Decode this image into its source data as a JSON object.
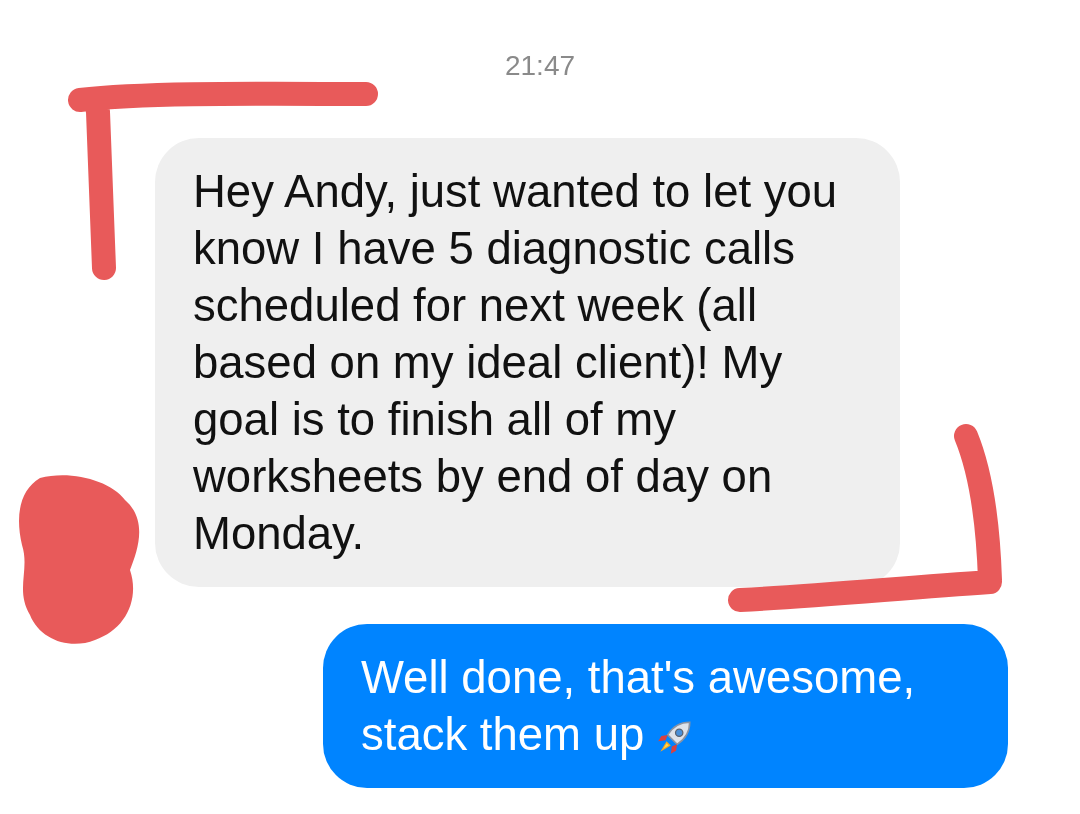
{
  "timestamp": "21:47",
  "messages": [
    {
      "kind": "incoming",
      "text": "Hey Andy, just wanted to let you know I have 5 diagnostic calls scheduled for next week (all based on my ideal client)! My goal is to finish all of my worksheets by end of day on Monday."
    },
    {
      "kind": "outgoing",
      "text": "Well done, that's awesome, stack them up"
    }
  ]
}
